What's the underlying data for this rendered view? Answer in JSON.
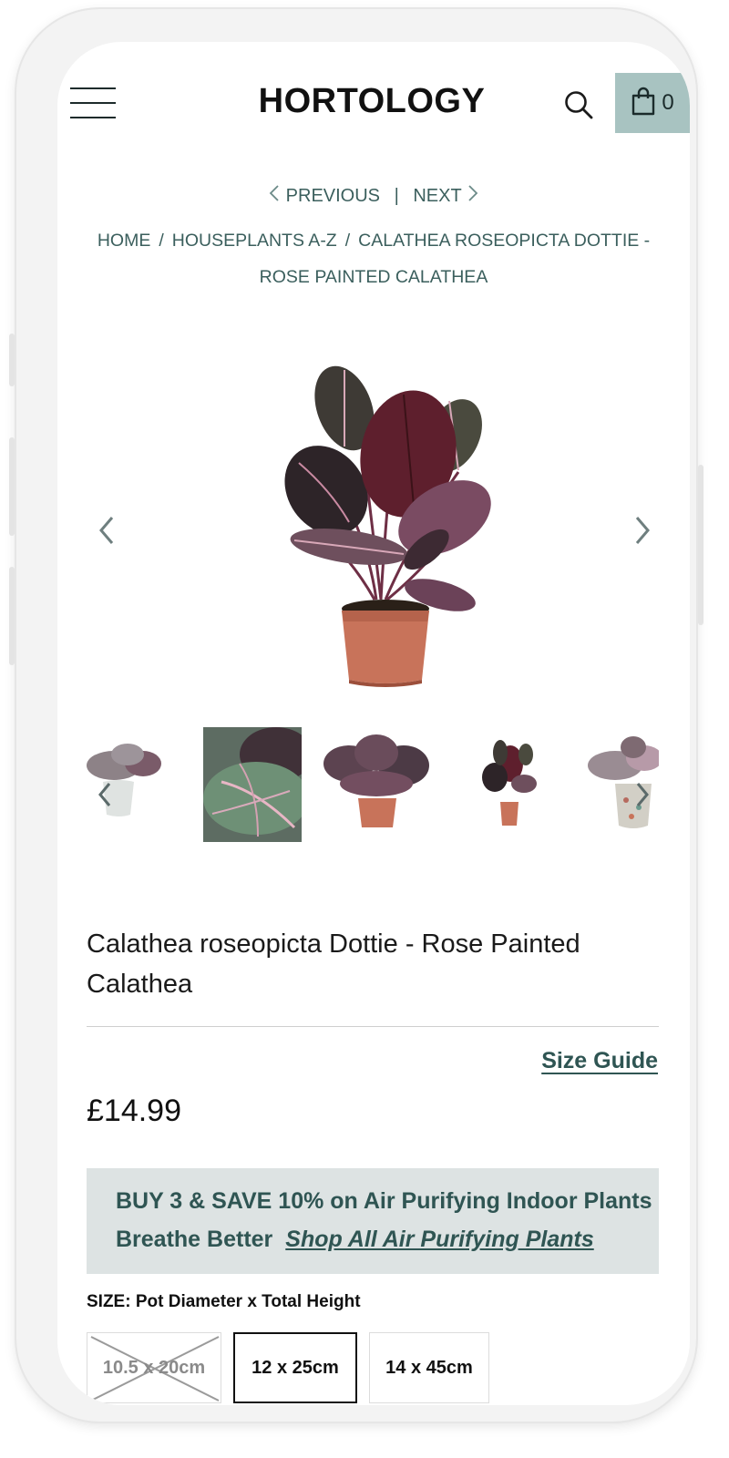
{
  "header": {
    "logo": "HORTOLOGY",
    "cart_count": "0",
    "cart_color": "#a8c3c1"
  },
  "pager": {
    "previous": "PREVIOUS",
    "separator": "|",
    "next": "NEXT"
  },
  "breadcrumb": {
    "items": [
      "HOME",
      "HOUSEPLANTS A-Z",
      "CALATHEA ROSEOPICTA DOTTIE - ROSE PAINTED CALATHEA"
    ],
    "separator": "/"
  },
  "product": {
    "title": "Calathea roseopicta Dottie - Rose Painted Calathea",
    "size_guide": "Size Guide",
    "price": "£14.99"
  },
  "promo": {
    "line1": "BUY 3 & SAVE 10% on Air Purifying Indoor Plants",
    "line2": "Breathe Better",
    "link": "Shop All Air Purifying Plants",
    "background": "#dde3e3",
    "text_color": "#2f5553"
  },
  "sizes": {
    "label": "SIZE: Pot Diameter x Total Height",
    "options": [
      {
        "label": "10.5 x 20cm",
        "state": "unavailable"
      },
      {
        "label": "12 x 25cm",
        "state": "selected"
      },
      {
        "label": "14 x 45cm",
        "state": "available"
      }
    ]
  },
  "icons": {
    "menu": "hamburger-menu-icon",
    "search": "search-icon",
    "cart": "shopping-bag-icon",
    "gallery_prev": "chevron-left-icon",
    "gallery_next": "chevron-right-icon"
  }
}
